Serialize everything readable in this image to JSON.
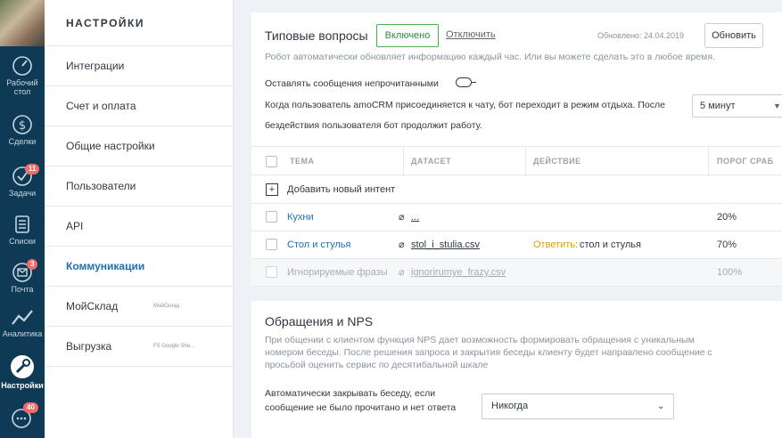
{
  "nav": {
    "items": [
      {
        "label1": "Рабочий",
        "label2": "стол",
        "icon": "dashboard-icon"
      },
      {
        "label1": "Сделки",
        "icon": "deals-icon"
      },
      {
        "label1": "Задачи",
        "icon": "tasks-icon",
        "badge": "11"
      },
      {
        "label1": "Списки",
        "icon": "lists-icon"
      },
      {
        "label1": "Почта",
        "icon": "mail-icon",
        "badge": "3"
      },
      {
        "label1": "Аналитика",
        "icon": "analytics-icon"
      },
      {
        "label1": "Настройки",
        "icon": "settings-icon"
      },
      {
        "icon": "chat-icon",
        "badge": "40"
      }
    ]
  },
  "sidebar": {
    "title": "НАСТРОЙКИ",
    "items": [
      {
        "label": "Интеграции"
      },
      {
        "label": "Счет и оплата"
      },
      {
        "label": "Общие настройки"
      },
      {
        "label": "Пользователи"
      },
      {
        "label": "API"
      },
      {
        "label": "Коммуникации"
      },
      {
        "label": "МойСклад",
        "tag": "МойСклад"
      },
      {
        "label": "Выгрузка",
        "tag": "FS Google She..."
      }
    ]
  },
  "faq": {
    "title": "Типовые вопросы",
    "enabled_label": "Включено",
    "disable_label": "Отключить",
    "updated": "Обновлено: 24.04.2019",
    "update_button": "Обновить",
    "description": "Робот автоматически обновляет информацию каждый час. Или вы можете сделать это в любое время.",
    "leave_unread": "Оставлять сообщения непрочитанными",
    "join_line1": "Когда пользователь amoCRM присоединяется к чату, бот переходит в режим отдыха. После",
    "join_line2": "бездействия пользователя бот продолжит работу.",
    "idle_value": "5 минут",
    "table": {
      "headers": [
        "ТЕМА",
        "ДАТАСЕТ",
        "ДЕЙСТВИЕ",
        "ПОРОГ СРАБ"
      ],
      "add_label": "Добавить новый интент",
      "rows": [
        {
          "name": "Кухни",
          "file": "...",
          "action_label": "",
          "action_value": "",
          "threshold": "20%"
        },
        {
          "name": "Стол и стулья",
          "file": "stol_i_stulia.csv",
          "action_label": "Ответить:",
          "action_value": "стол и стулья",
          "threshold": "70%"
        },
        {
          "name": "Игнорируемые фразы",
          "file": "ignorirumye_frazy.csv",
          "action_label": "",
          "action_value": "",
          "threshold": "100%"
        }
      ]
    }
  },
  "nps": {
    "title": "Обращения и NPS",
    "desc1": "При общении с клиентом функция NPS дает возможность формировать обращения с уникальным",
    "desc2": "номером беседы. После решения запроса и закрытия беседы клиенту будет направлено сообщение с",
    "desc3": "просьбой оценить сервис по десятибальной шкале",
    "autoclose1": "Автоматически закрывать беседу, если",
    "autoclose2": "сообщение не было прочитано и нет ответа",
    "autoclose_value": "Никогда"
  }
}
